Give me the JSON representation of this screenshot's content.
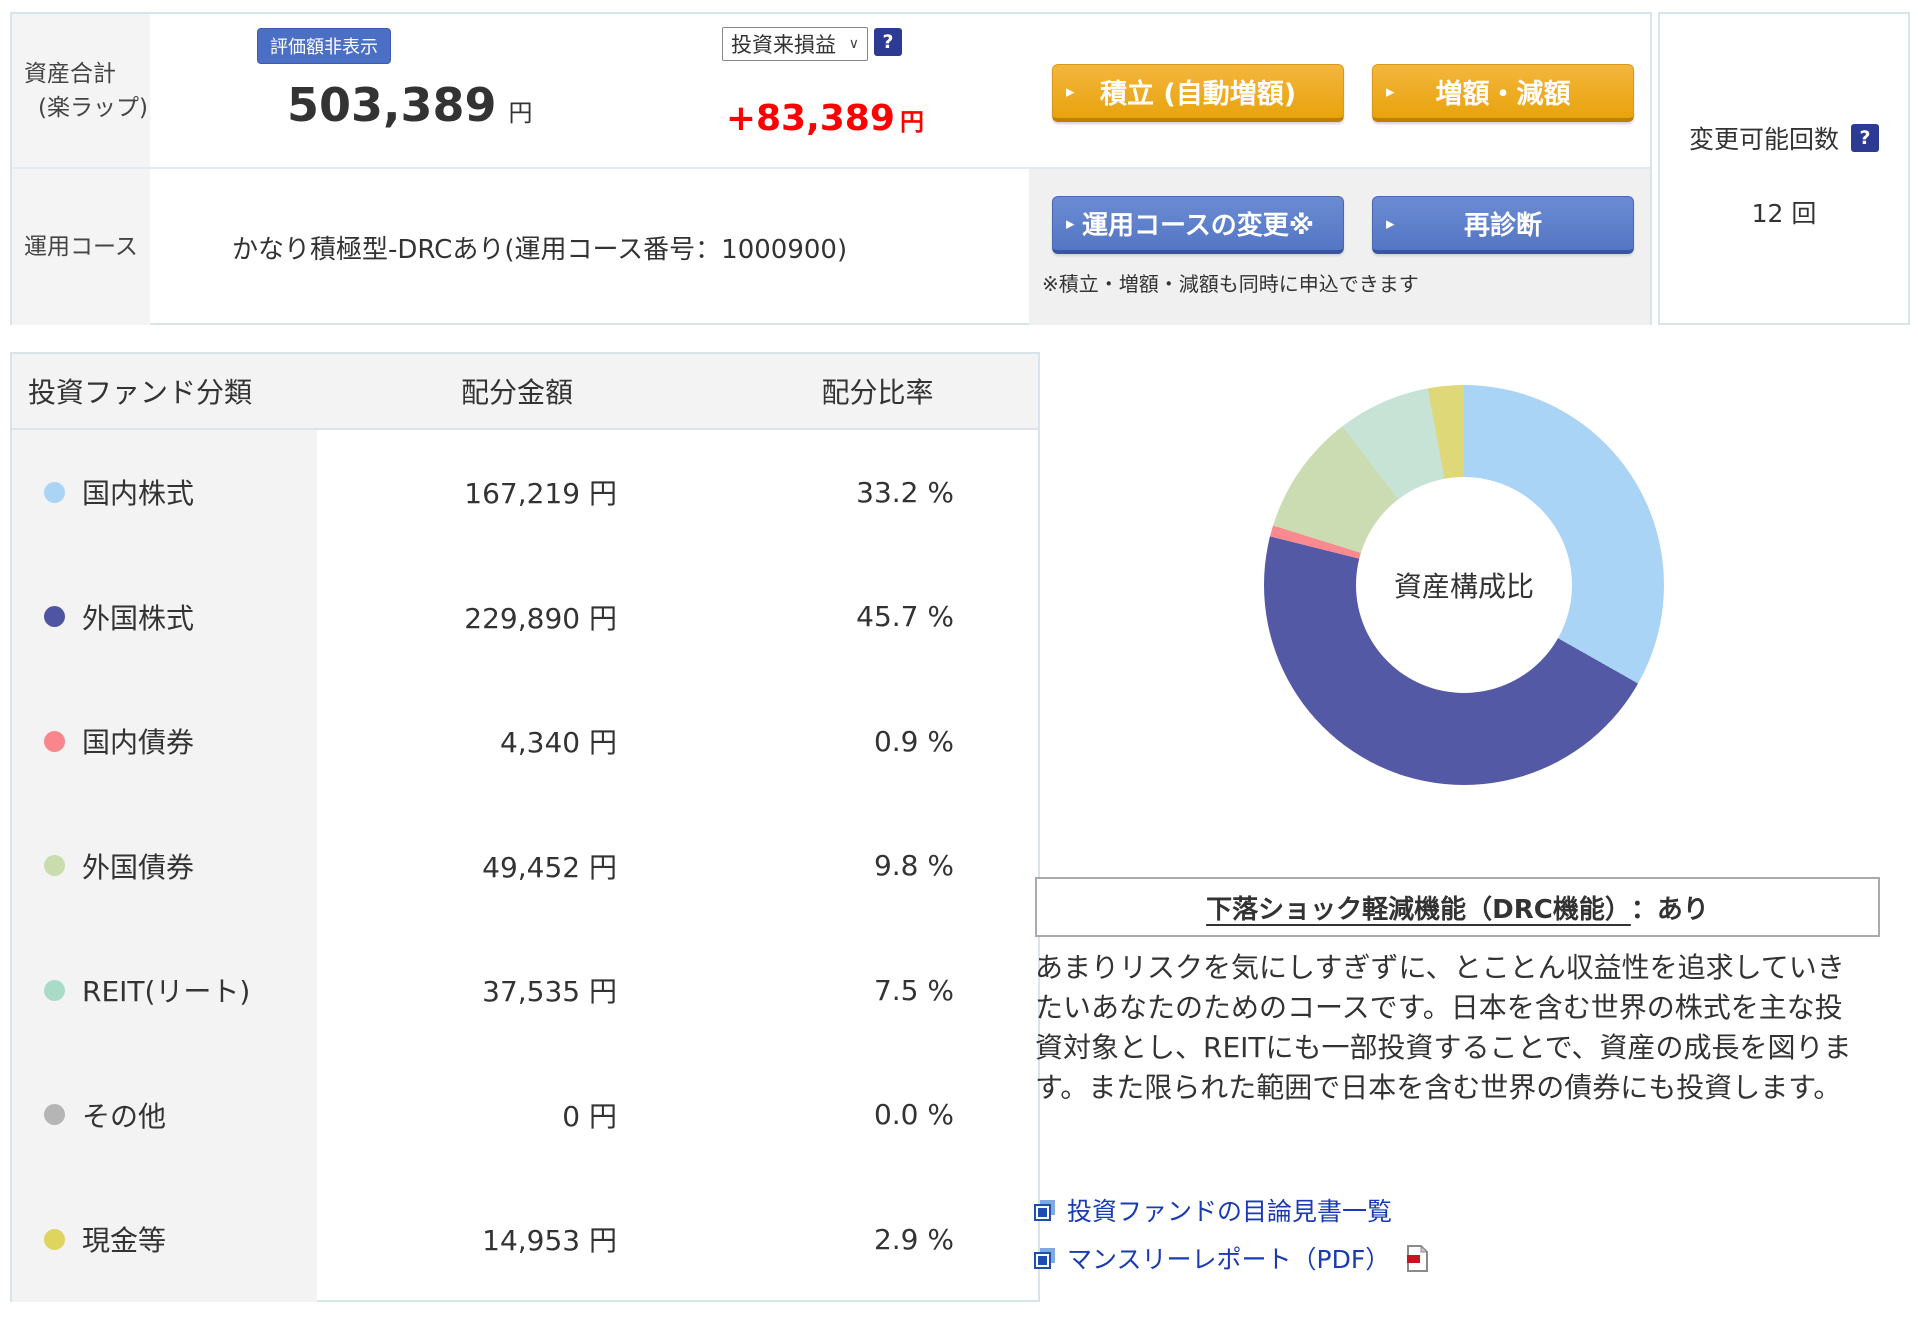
{
  "summary": {
    "total_label_line1": "資産合計",
    "total_label_line2": "(楽ラップ)",
    "hide_badge": "評価額非表示",
    "total_value": "503,389",
    "total_unit": "円",
    "pl_dropdown_value": "投資来損益",
    "pl_value": "+83,389",
    "pl_unit": "円",
    "tsumitate_button": "積立 (自動増額)",
    "zougaku_button": "増額・減額",
    "course_label": "運用コース",
    "course_value": "かなり積極型-DRCあり(運用コース番号：1000900)",
    "course_change_button": "運用コースの変更※",
    "rediagnosis_button": "再診断",
    "note": "※積立・増額・減額も同時に申込できます",
    "change_count_label": "変更可能回数",
    "change_count_value": "12 回"
  },
  "ui": {
    "button_marker": "▸",
    "dropdown_chevron": "∨",
    "help_glyph": "?"
  },
  "allocation_table": {
    "headers": [
      "投資ファンド分類",
      "配分金額",
      "配分比率"
    ],
    "rows": [
      {
        "label": "国内株式",
        "color": "#a9d4f5",
        "amount": "167,219 円",
        "ratio": "33.2 %"
      },
      {
        "label": "外国株式",
        "color": "#4f55a0",
        "amount": "229,890 円",
        "ratio": "45.7 %"
      },
      {
        "label": "国内債券",
        "color": "#f9868d",
        "amount": "4,340 円",
        "ratio": "0.9 %"
      },
      {
        "label": "外国債券",
        "color": "#c8dcae",
        "amount": "49,452 円",
        "ratio": "9.8 %"
      },
      {
        "label": "REIT(リート)",
        "color": "#a9dcc8",
        "amount": "37,535 円",
        "ratio": "7.5 %"
      },
      {
        "label": "その他",
        "color": "#b5b5b5",
        "amount": "0 円",
        "ratio": "0.0 %"
      },
      {
        "label": "現金等",
        "color": "#ddd55e",
        "amount": "14,953 円",
        "ratio": "2.9 %"
      }
    ]
  },
  "chart_data": {
    "type": "pie",
    "subtype": "donut",
    "center_label": "資産構成比",
    "labels": [
      "国内株式",
      "外国株式",
      "国内債券",
      "外国債券",
      "REIT(リート)",
      "その他",
      "現金等"
    ],
    "values": [
      33.2,
      45.7,
      0.9,
      9.8,
      7.5,
      0.0,
      2.9
    ],
    "colors": [
      "#a9d4f5",
      "#5359a5",
      "#fa8a90",
      "#ccdcb2",
      "#c6e3d6",
      "#b5b5b5",
      "#ded878"
    ],
    "start_angle_deg": 0,
    "direction": "clockwise"
  },
  "drc": {
    "title_main": "下落ショック軽減機能（DRC機能）",
    "title_suffix": "：あり"
  },
  "description": "あまりリスクを気にしすぎずに、とことん収益性を追求していきたいあなたのためのコースです。日本を含む世界の株式を主な投資対象とし、REITにも一部投資することで、資産の成長を図ります。また限られた範囲で日本を含む世界の債券にも投資します。",
  "links": [
    {
      "label": "投資ファンドの目論見書一覧",
      "pdf": false
    },
    {
      "label": "マンスリーレポート（PDF）",
      "pdf": true
    }
  ]
}
